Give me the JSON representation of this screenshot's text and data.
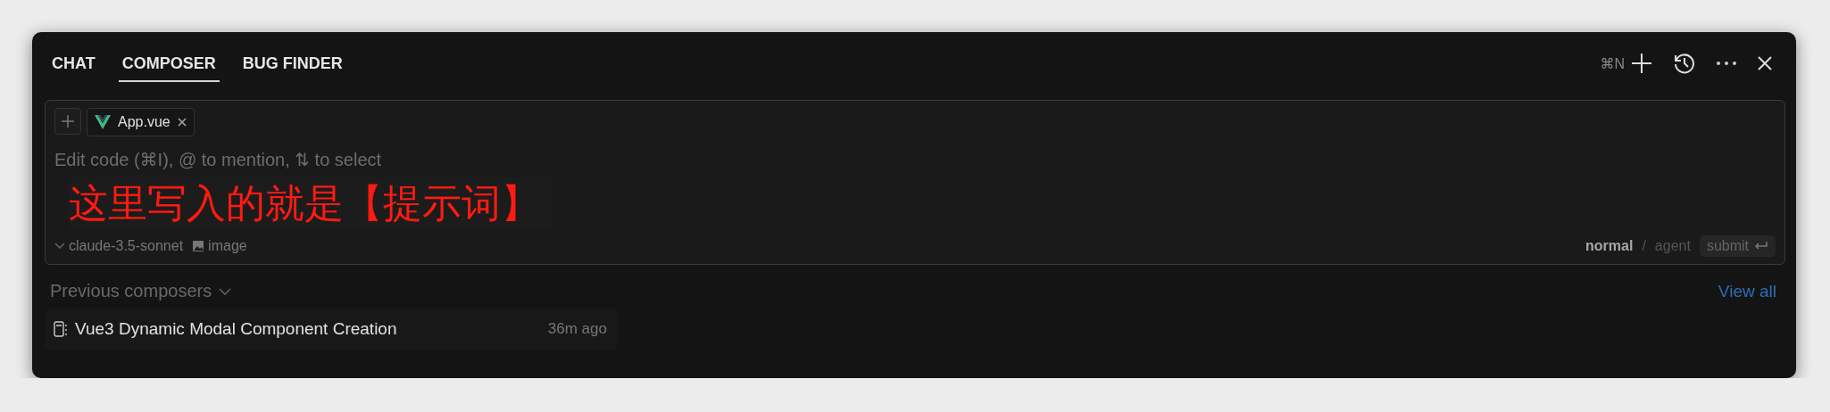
{
  "tabs": [
    {
      "label": "CHAT",
      "selected": false
    },
    {
      "label": "COMPOSER",
      "selected": true
    },
    {
      "label": "BUG FINDER",
      "selected": false
    }
  ],
  "toolbar": {
    "new_shortcut": "⌘N"
  },
  "composer": {
    "file_chips": [
      {
        "name": "App.vue"
      }
    ],
    "placeholder": "Edit code (⌘I), @ to mention, ⇅ to select",
    "annotation": "这里写入的就是【提示词】",
    "model": "claude-3.5-sonnet",
    "image_label": "image",
    "modes": [
      {
        "label": "normal",
        "selected": true
      },
      {
        "label": "agent",
        "selected": false
      }
    ],
    "mode_separator": "/",
    "submit": "submit"
  },
  "previous": {
    "heading": "Previous composers",
    "view_all": "View all",
    "items": [
      {
        "title": "Vue3 Dynamic Modal Component Creation",
        "time": "36m ago"
      }
    ]
  }
}
